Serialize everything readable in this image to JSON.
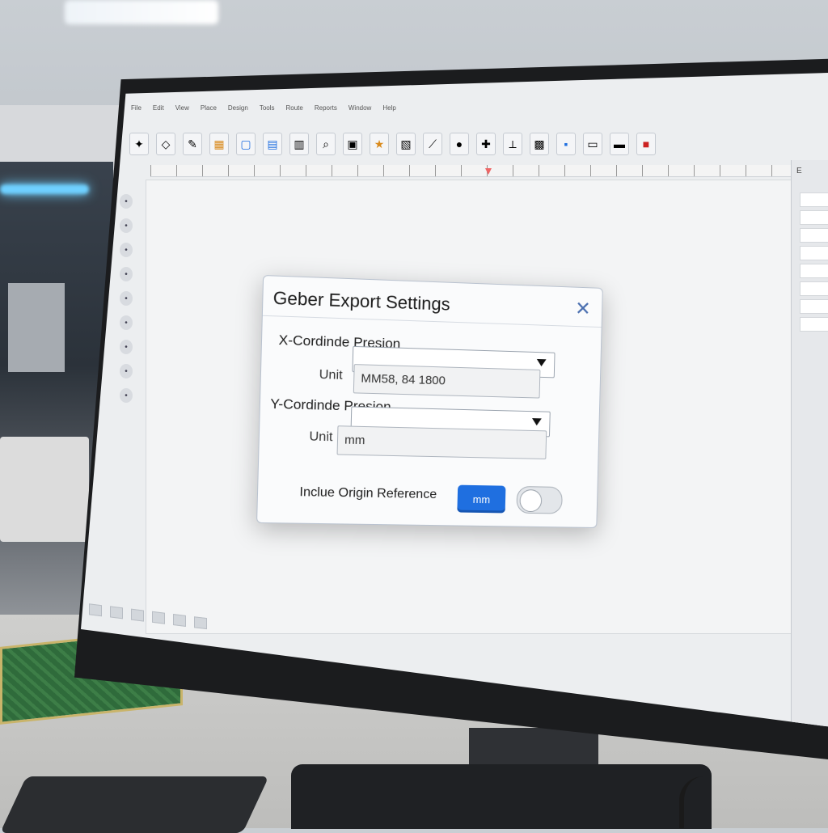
{
  "app": {
    "menu": [
      "File",
      "Edit",
      "View",
      "Place",
      "Design",
      "Tools",
      "Route",
      "Reports",
      "Window",
      "Help"
    ],
    "toolbar_icons": [
      "pointer-icon",
      "shape-icon",
      "pen-icon",
      "component-icon",
      "page-icon",
      "document-icon",
      "layer-icon",
      "search-icon",
      "folder-icon",
      "star-icon",
      "note-icon",
      "wire-icon",
      "pad-icon",
      "probe-icon",
      "drill-icon",
      "board-icon",
      "chip-icon",
      "save-icon",
      "print-icon",
      "close-doc-icon"
    ],
    "left_tools": [
      "select-tool-icon",
      "move-tool-icon",
      "route-tool-icon",
      "via-tool-icon",
      "pad-tool-icon",
      "measure-tool-icon",
      "text-tool-icon",
      "rotate-tool-icon",
      "zoom-tool-icon"
    ],
    "right_panel_label": "E"
  },
  "dialog": {
    "title": "Geber Export Settings",
    "x_label": "X-Cordinde Presion",
    "x_unit_label": "Unit",
    "x_unit_value": "MM58, 84 1800",
    "y_label": "Y-Cordinde Presion",
    "y_unit_label": "Unit",
    "y_unit_value": "mm",
    "origin_label": "Inclue Origin Reference",
    "unit_button_label": "mm",
    "origin_toggle_on": false
  },
  "colors": {
    "accent": "#1f6fe0",
    "close": "#4a6fb0"
  }
}
